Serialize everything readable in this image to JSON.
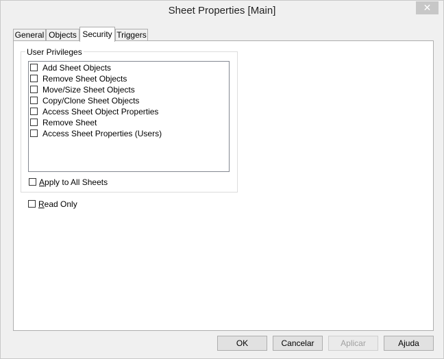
{
  "window": {
    "title": "Sheet Properties [Main]",
    "close_glyph": "✕"
  },
  "tabs": [
    {
      "label": "General",
      "active": false
    },
    {
      "label": "Objects",
      "active": false
    },
    {
      "label": "Security",
      "active": true
    },
    {
      "label": "Triggers",
      "active": false
    }
  ],
  "security": {
    "group_label": "User Privileges",
    "privileges": [
      {
        "label": "Add Sheet Objects",
        "checked": false
      },
      {
        "label": "Remove Sheet Objects",
        "checked": false
      },
      {
        "label": "Move/Size Sheet Objects",
        "checked": false
      },
      {
        "label": "Copy/Clone Sheet Objects",
        "checked": false
      },
      {
        "label": "Access Sheet Object Properties",
        "checked": false
      },
      {
        "label": "Remove Sheet",
        "checked": false
      },
      {
        "label": "Access Sheet Properties (Users)",
        "checked": false
      }
    ],
    "apply_all": {
      "mnemonic": "A",
      "rest": "pply to All Sheets",
      "checked": false
    },
    "read_only": {
      "mnemonic": "R",
      "rest": "ead Only",
      "checked": false
    }
  },
  "buttons": {
    "ok": "OK",
    "cancel": "Cancelar",
    "apply": "Aplicar",
    "help": "Ajuda"
  }
}
